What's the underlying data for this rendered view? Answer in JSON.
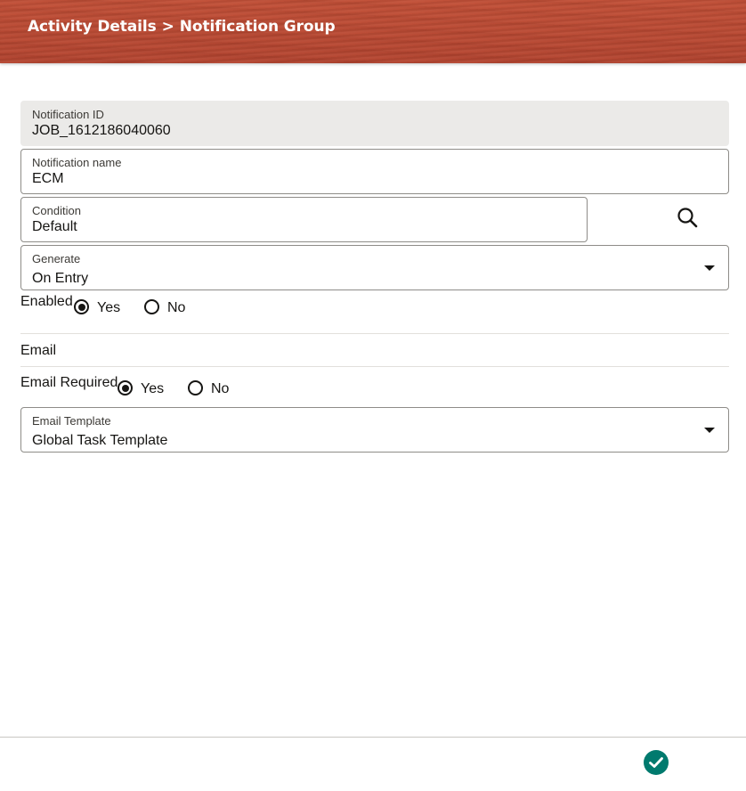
{
  "header": {
    "breadcrumb_parent": "Activity Details",
    "separator": ">",
    "breadcrumb_current": "Notification Group",
    "background_color": "#b64832"
  },
  "form": {
    "notification_id": {
      "label": "Notification ID",
      "value": "JOB_1612186040060"
    },
    "notification_name": {
      "label": "Notification name",
      "value": "ECM"
    },
    "condition": {
      "label": "Condition",
      "value": "Default",
      "search_icon": "search-icon"
    },
    "generate": {
      "label": "Generate",
      "value": "On Entry"
    },
    "enabled": {
      "label": "Enabled",
      "options": [
        "Yes",
        "No"
      ],
      "selected": "Yes"
    }
  },
  "email_section": {
    "title": "Email",
    "email_required": {
      "label": "Email Required",
      "options": [
        "Yes",
        "No"
      ],
      "selected": "Yes"
    },
    "email_template": {
      "label": "Email Template",
      "value": "Global Task Template"
    }
  },
  "footer": {
    "confirm_icon": "check-circle-icon",
    "confirm_color": "#007a6e"
  }
}
